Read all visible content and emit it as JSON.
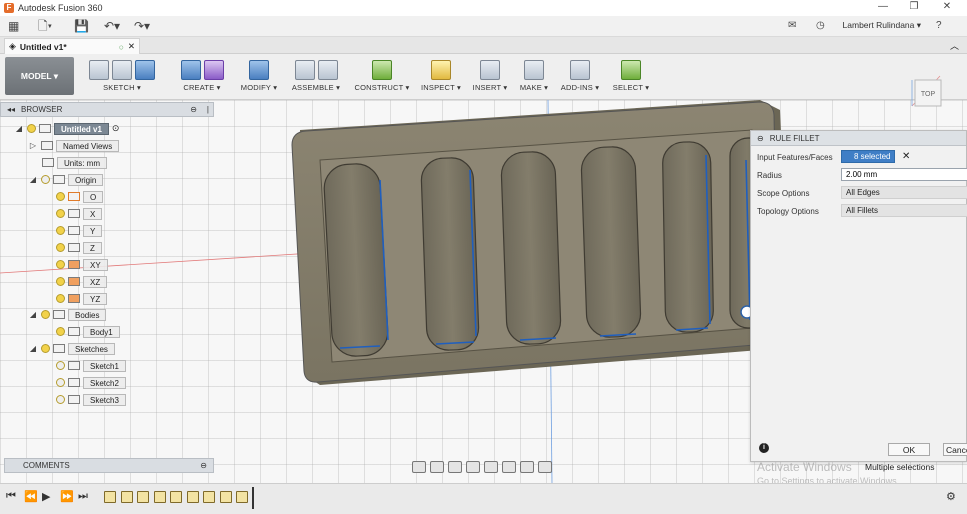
{
  "window": {
    "title": "Autodesk Fusion 360",
    "app_icon": "F"
  },
  "quick_access": {
    "user": "Lambert Rulindana ▾",
    "help": "?"
  },
  "document_tab": {
    "label": "Untitled v1*"
  },
  "toolbar": {
    "workspace": "MODEL ▾",
    "groups": [
      {
        "label": "SKETCH ▾"
      },
      {
        "label": "CREATE ▾"
      },
      {
        "label": "MODIFY ▾"
      },
      {
        "label": "ASSEMBLE ▾"
      },
      {
        "label": "CONSTRUCT ▾"
      },
      {
        "label": "INSPECT ▾"
      },
      {
        "label": "INSERT ▾"
      },
      {
        "label": "MAKE ▾"
      },
      {
        "label": "ADD-INS ▾"
      },
      {
        "label": "SELECT ▾"
      }
    ]
  },
  "viewcube": {
    "face": "TOP"
  },
  "browser": {
    "title": "BROWSER",
    "root": "Untitled v1",
    "named_views": "Named Views",
    "units": "Units: mm",
    "origin": "Origin",
    "origin_items": [
      "O",
      "X",
      "Y",
      "Z",
      "XY",
      "XZ",
      "YZ"
    ],
    "bodies": "Bodies",
    "body1": "Body1",
    "sketches": "Sketches",
    "sketch_items": [
      "Sketch1",
      "Sketch2",
      "Sketch3"
    ]
  },
  "comments": {
    "title": "COMMENTS"
  },
  "fillet_dialog": {
    "title": "RULE FILLET",
    "rows": [
      {
        "label": "Input Features/Faces",
        "value": "8 selected"
      },
      {
        "label": "Radius",
        "value": "2.00 mm"
      },
      {
        "label": "Scope Options",
        "value": "All Edges"
      },
      {
        "label": "Topology Options",
        "value": "All Fillets"
      }
    ],
    "ok": "OK",
    "cancel": "Cancel"
  },
  "status": {
    "activate_title": "Activate Windows",
    "activate_sub": "Go to Settings to activate Windows.",
    "selection": "Multiple selections"
  },
  "colors": {
    "part": "#7f7866",
    "part_dark": "#5d5849",
    "selection": "#1f5fbf",
    "toolbar_bg": "#efefef"
  }
}
